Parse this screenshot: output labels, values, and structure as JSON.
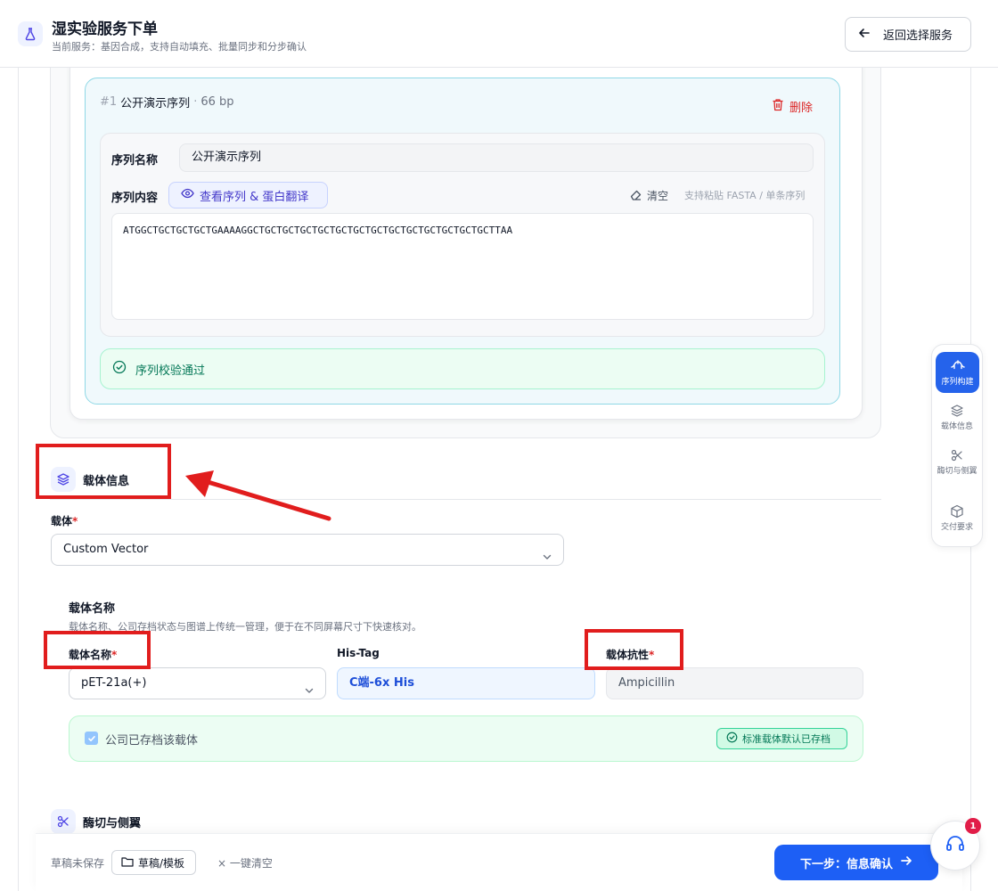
{
  "header": {
    "title": "湿实验服务下单",
    "subtitle": "当前服务：基因合成，支持自动填充、批量同步和分步确认",
    "back_label": "返回选择服务"
  },
  "sequence": {
    "index": "#1",
    "name": "公开演示序列",
    "dot": "·",
    "length": "66 bp",
    "delete_label": "删除",
    "name_label": "序列名称",
    "name_value": "公开演示序列",
    "content_label": "序列内容",
    "view_label": "查看序列 & 蛋白翻译",
    "clear_label": "清空",
    "paste_hint": "支持粘贴 FASTA / 单条序列",
    "content_value": "ATGGCTGCTGCTGCTGAAAAGGCTGCTGCTGCTGCTGCTGCTGCTGCTGCTGCTGCTGCTGCTTAA",
    "valid_text": "序列校验通过"
  },
  "vector_section": {
    "title": "载体信息",
    "vector_label": "载体",
    "required_mark": "*",
    "vector_value": "Custom Vector",
    "subsection_title": "载体名称",
    "subsection_desc": "载体名称、公司存档状态与图谱上传统一管理，便于在不同屏幕尺寸下快速核对。",
    "name_label": "载体名称",
    "name_value": "pET-21a(+)",
    "tag_label": "His-Tag",
    "tag_value": "C端-6x His",
    "resistance_label": "载体抗性",
    "resistance_value": "Ampicillin",
    "archived_text": "公司已存档该载体",
    "standard_badge": "标准载体默认已存档"
  },
  "next_section": {
    "title": "酶切与侧翼"
  },
  "side_nav": {
    "items": [
      {
        "label": "序列构建",
        "active": true,
        "icon": "sequence-icon"
      },
      {
        "label": "载体信息",
        "active": false,
        "icon": "layers-icon"
      },
      {
        "label": "酶切与侧翼",
        "active": false,
        "icon": "scissors-icon"
      },
      {
        "label": "交付要求",
        "active": false,
        "icon": "box-icon"
      }
    ]
  },
  "footer": {
    "draft_status": "草稿未保存",
    "draft_button": "草稿/模板",
    "clear_all": "一键清空",
    "clear_all_icon": "×",
    "next_button": "下一步：信息确认",
    "support_badge": "1"
  },
  "colors": {
    "primary": "#1d5ff5",
    "success": "#047857",
    "danger": "#dc2626",
    "annotation": "#e11d1d"
  }
}
